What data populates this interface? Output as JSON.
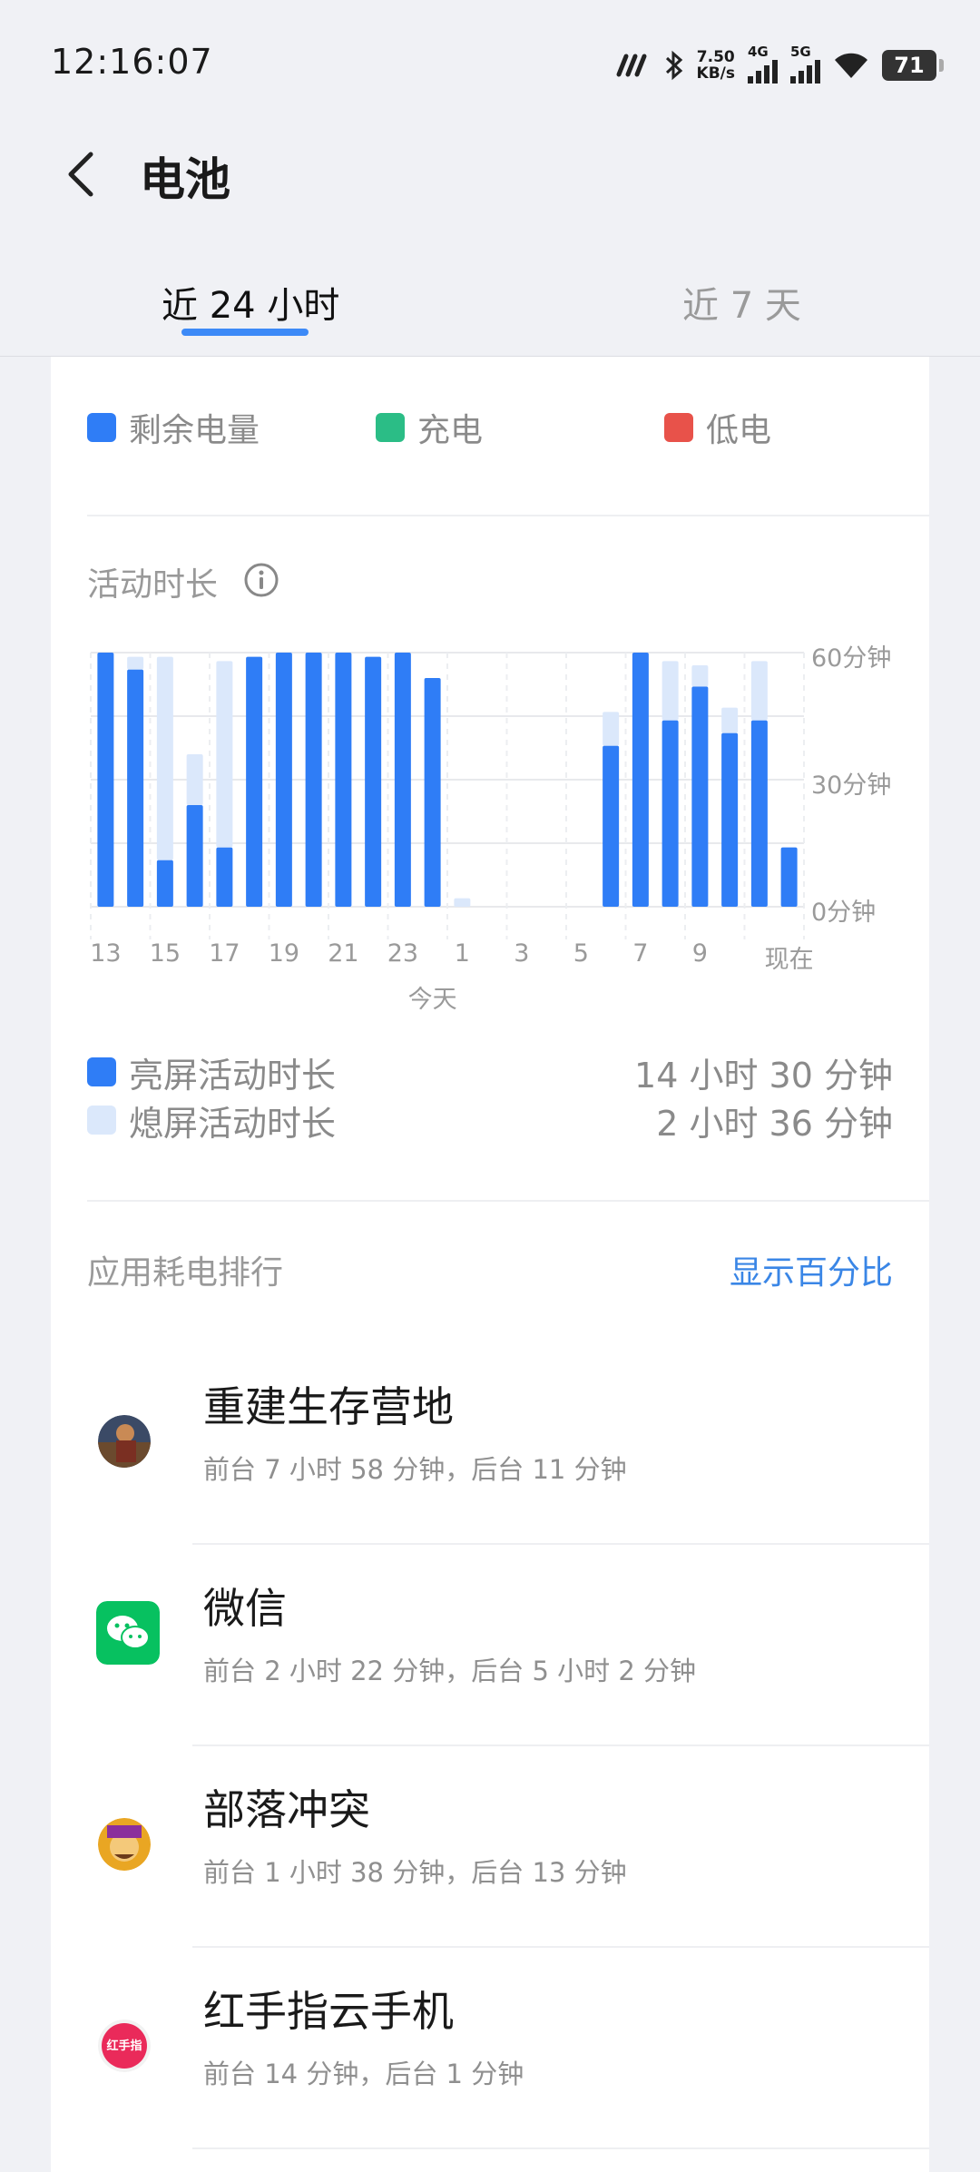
{
  "status_bar": {
    "time": "12:16:07",
    "net_speed_value": "7.50",
    "net_speed_unit": "KB/s",
    "sim1_label": "4G",
    "sim2_label": "5G",
    "battery_level": "71"
  },
  "header": {
    "title": "电池"
  },
  "tabs": [
    {
      "label": "近 24 小时",
      "active": true
    },
    {
      "label": "近 7 天",
      "active": false
    }
  ],
  "battery_legend": {
    "remaining": "剩余电量",
    "charging": "充电",
    "low": "低电"
  },
  "activity": {
    "title": "活动时长",
    "today_label": "今天",
    "screen_on_label": "亮屏活动时长",
    "screen_on_value": "14 小时 30 分钟",
    "screen_off_label": "熄屏活动时长",
    "screen_off_value": "2 小时 36 分钟"
  },
  "chart_data": {
    "type": "bar",
    "stacked": true,
    "categories": [
      "13",
      "14",
      "15",
      "16",
      "17",
      "18",
      "19",
      "20",
      "21",
      "22",
      "23",
      "0",
      "1",
      "2",
      "3",
      "4",
      "5",
      "6",
      "7",
      "8",
      "9",
      "10",
      "11",
      "现在"
    ],
    "x_tick_labels": [
      "13",
      "15",
      "17",
      "19",
      "21",
      "23",
      "1",
      "3",
      "5",
      "7",
      "9",
      "现在"
    ],
    "y_ticks": [
      "0分钟",
      "30分钟",
      "60分钟"
    ],
    "ylim": [
      0,
      60
    ],
    "series": [
      {
        "name": "亮屏活动时长",
        "color": "#2f7df6",
        "values": [
          60,
          56,
          11,
          24,
          14,
          59,
          60,
          60,
          60,
          59,
          60,
          54,
          0,
          0,
          0,
          0,
          0,
          38,
          60,
          44,
          52,
          41,
          44,
          14
        ]
      },
      {
        "name": "熄屏活动时长",
        "color": "#dbe8fb",
        "values": [
          0,
          3,
          48,
          12,
          44,
          0,
          0,
          0,
          0,
          0,
          0,
          0,
          2,
          0,
          0,
          0,
          0,
          8,
          0,
          14,
          5,
          6,
          14,
          0
        ]
      }
    ],
    "x_group_label": "今天"
  },
  "ranking": {
    "title": "应用耗电排行",
    "toggle_label": "显示百分比",
    "apps": [
      {
        "name": "重建生存营地",
        "detail": "前台 7 小时 58 分钟，后台 11 分钟",
        "icon": "game-survival-icon"
      },
      {
        "name": "微信",
        "detail": "前台 2 小时 22 分钟，后台 5 小时 2 分钟",
        "icon": "wechat-icon"
      },
      {
        "name": "部落冲突",
        "detail": "前台 1 小时 38 分钟，后台 13 分钟",
        "icon": "clash-of-clans-icon"
      },
      {
        "name": "红手指云手机",
        "detail": "前台 14 分钟，后台 1 分钟",
        "icon": "redfinger-icon",
        "icon_text": "红手指"
      }
    ]
  },
  "colors": {
    "accent": "#3d8af7",
    "remaining": "#2f7df6",
    "charging": "#2bbd86",
    "low": "#e8524a",
    "screen_off": "#dbe8fb"
  }
}
